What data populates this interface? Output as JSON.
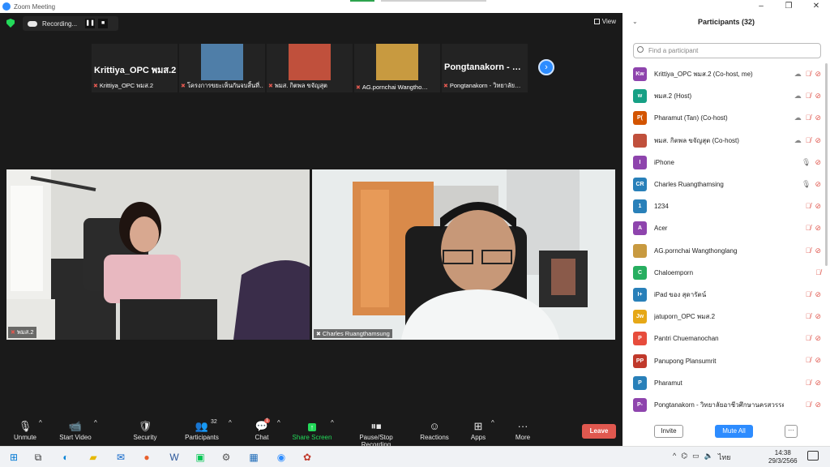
{
  "window": {
    "title": "Zoom Meeting",
    "controls": [
      "–",
      "❐",
      "✕"
    ]
  },
  "meeting": {
    "recording_label": "Recording...",
    "view_label": "View",
    "thumbnails": [
      {
        "big_name": "Krittiya_OPC พมส.2",
        "caption": "Krittiya_OPC พมส.2",
        "has_photo": false
      },
      {
        "big_name": "",
        "caption": "โครงการขยะเห็นกันจบสิ้นที่…",
        "has_photo": true,
        "photo_color": "#4f7ea8"
      },
      {
        "big_name": "",
        "caption": "พมส. กิตพล ขจัญสุต",
        "has_photo": true,
        "photo_color": "#c0503c"
      },
      {
        "big_name": "",
        "caption": "AG.pornchai Wangtho…",
        "has_photo": true,
        "photo_color": "#c89a40"
      },
      {
        "big_name": "Pongtanakorn - …",
        "caption": "Pongtanakorn - วิทยาลัย…",
        "has_photo": false
      }
    ],
    "video_left_caption": "พมส.2",
    "video_right_caption": "Charles Ruangthamsung"
  },
  "toolbar": {
    "unmute": "Unmute",
    "start_video": "Start Video",
    "security": "Security",
    "participants": "Participants",
    "participants_count": "32",
    "chat": "Chat",
    "chat_badge": "1",
    "share_screen": "Share Screen",
    "pause_stop_recording": "Pause/Stop Recording",
    "reactions": "Reactions",
    "apps": "Apps",
    "more": "More",
    "leave": "Leave"
  },
  "panel": {
    "title": "Participants (32)",
    "search_placeholder": "Find a participant",
    "participants": [
      {
        "initials": "Kw",
        "name": "Krittiya_OPC พมส.2 (Co-host, me)",
        "color": "#8e44ad",
        "cloud": true,
        "mic": "off",
        "cam": "off"
      },
      {
        "initials": "w",
        "name": "พมส.2 (Host)",
        "color": "#16a085",
        "cloud": true,
        "mic": "off",
        "cam": "off"
      },
      {
        "initials": "P(",
        "name": "Pharamut (Tan) (Co-host)",
        "color": "#d35400",
        "cloud": true,
        "mic": "off",
        "cam": "off"
      },
      {
        "initials": "",
        "name": "พมส. กิตพล ขจัญสุต (Co-host)",
        "color": "#c0503c",
        "cloud": true,
        "mic": "off",
        "cam": "off"
      },
      {
        "initials": "I",
        "name": "iPhone",
        "color": "#8e44ad",
        "cloud": false,
        "mic": "on",
        "cam": "off"
      },
      {
        "initials": "CR",
        "name": "Charles Ruangthamsing",
        "color": "#2980b9",
        "cloud": false,
        "mic": "on",
        "cam": "off"
      },
      {
        "initials": "1",
        "name": "1234",
        "color": "#2980b9",
        "cloud": false,
        "mic": "off",
        "cam": "off"
      },
      {
        "initials": "A",
        "name": "Acer",
        "color": "#8e44ad",
        "cloud": false,
        "mic": "off",
        "cam": "off"
      },
      {
        "initials": "",
        "name": "AG.pornchai Wangthonglang",
        "color": "#c89a40",
        "cloud": false,
        "mic": "off",
        "cam": "off"
      },
      {
        "initials": "C",
        "name": "Chaloemporn",
        "color": "#27ae60",
        "cloud": false,
        "mic": "off",
        "cam": "none"
      },
      {
        "initials": "I+",
        "name": "iPad ของ สุดารัตน์",
        "color": "#2980b9",
        "cloud": false,
        "mic": "off",
        "cam": "off"
      },
      {
        "initials": "Jw",
        "name": "jatuporn_OPC พมส.2",
        "color": "#e6a817",
        "cloud": false,
        "mic": "off",
        "cam": "off"
      },
      {
        "initials": "P",
        "name": "Pantri Chuemanochan",
        "color": "#e74c3c",
        "cloud": false,
        "mic": "off",
        "cam": "off"
      },
      {
        "initials": "PP",
        "name": "Panupong Plansumrit",
        "color": "#c0392b",
        "cloud": false,
        "mic": "off",
        "cam": "off"
      },
      {
        "initials": "P",
        "name": "Pharamut",
        "color": "#2980b9",
        "cloud": false,
        "mic": "off",
        "cam": "off"
      },
      {
        "initials": "P-",
        "name": "Pongtanakorn - วิทยาลัยอาชีวศึกษานครสวรรค์",
        "color": "#8e44ad",
        "cloud": false,
        "mic": "off",
        "cam": "off"
      }
    ],
    "invite": "Invite",
    "mute_all": "Mute All",
    "more": "···"
  },
  "taskbar": {
    "clock_time": "14:38",
    "clock_date": "29/3/2566",
    "lang": "ไทย"
  }
}
